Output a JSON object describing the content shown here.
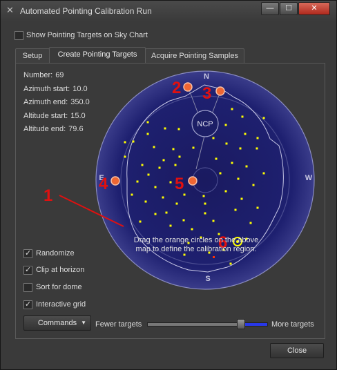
{
  "window": {
    "title": "Automated Pointing Calibration Run",
    "minimize": "—",
    "maximize": "☐",
    "close": "✕"
  },
  "show_targets": {
    "label": "Show Pointing Targets on Sky Chart",
    "checked": false
  },
  "tabs": [
    {
      "label": "Setup",
      "active": false
    },
    {
      "label": "Create Pointing Targets",
      "active": true
    },
    {
      "label": "Acquire Pointing Samples",
      "active": false
    }
  ],
  "stats": [
    {
      "label": "Number:",
      "value": "69"
    },
    {
      "label": "Azimuth start:",
      "value": "10.0"
    },
    {
      "label": "Azimuth end:",
      "value": "350.0"
    },
    {
      "label": "Altitude start:",
      "value": "15.0"
    },
    {
      "label": "Altitude end:",
      "value": "79.6"
    }
  ],
  "options": [
    {
      "label": "Randomize",
      "checked": true
    },
    {
      "label": "Clip at horizon",
      "checked": true
    },
    {
      "label": "Sort for dome",
      "checked": false
    },
    {
      "label": "Interactive grid",
      "checked": true
    }
  ],
  "commands_button": "Commands",
  "hint": "Drag the orange circles on the above map to define the calibration region.",
  "density": {
    "fewer": "Fewer targets",
    "more": "More targets",
    "value": 0.78
  },
  "close_button": "Close",
  "sky_map": {
    "compass": {
      "n": "N",
      "s": "S",
      "e": "E",
      "w": "W"
    },
    "ncp": "NCP",
    "annotations": [
      "1",
      "2",
      "3",
      "4",
      "5",
      "6"
    ],
    "colors": {
      "sky": "#1c1e6a",
      "targets": "#ffff00",
      "handles": "#ee6633",
      "annotation": "#e01010",
      "current": "#ffff00"
    }
  }
}
